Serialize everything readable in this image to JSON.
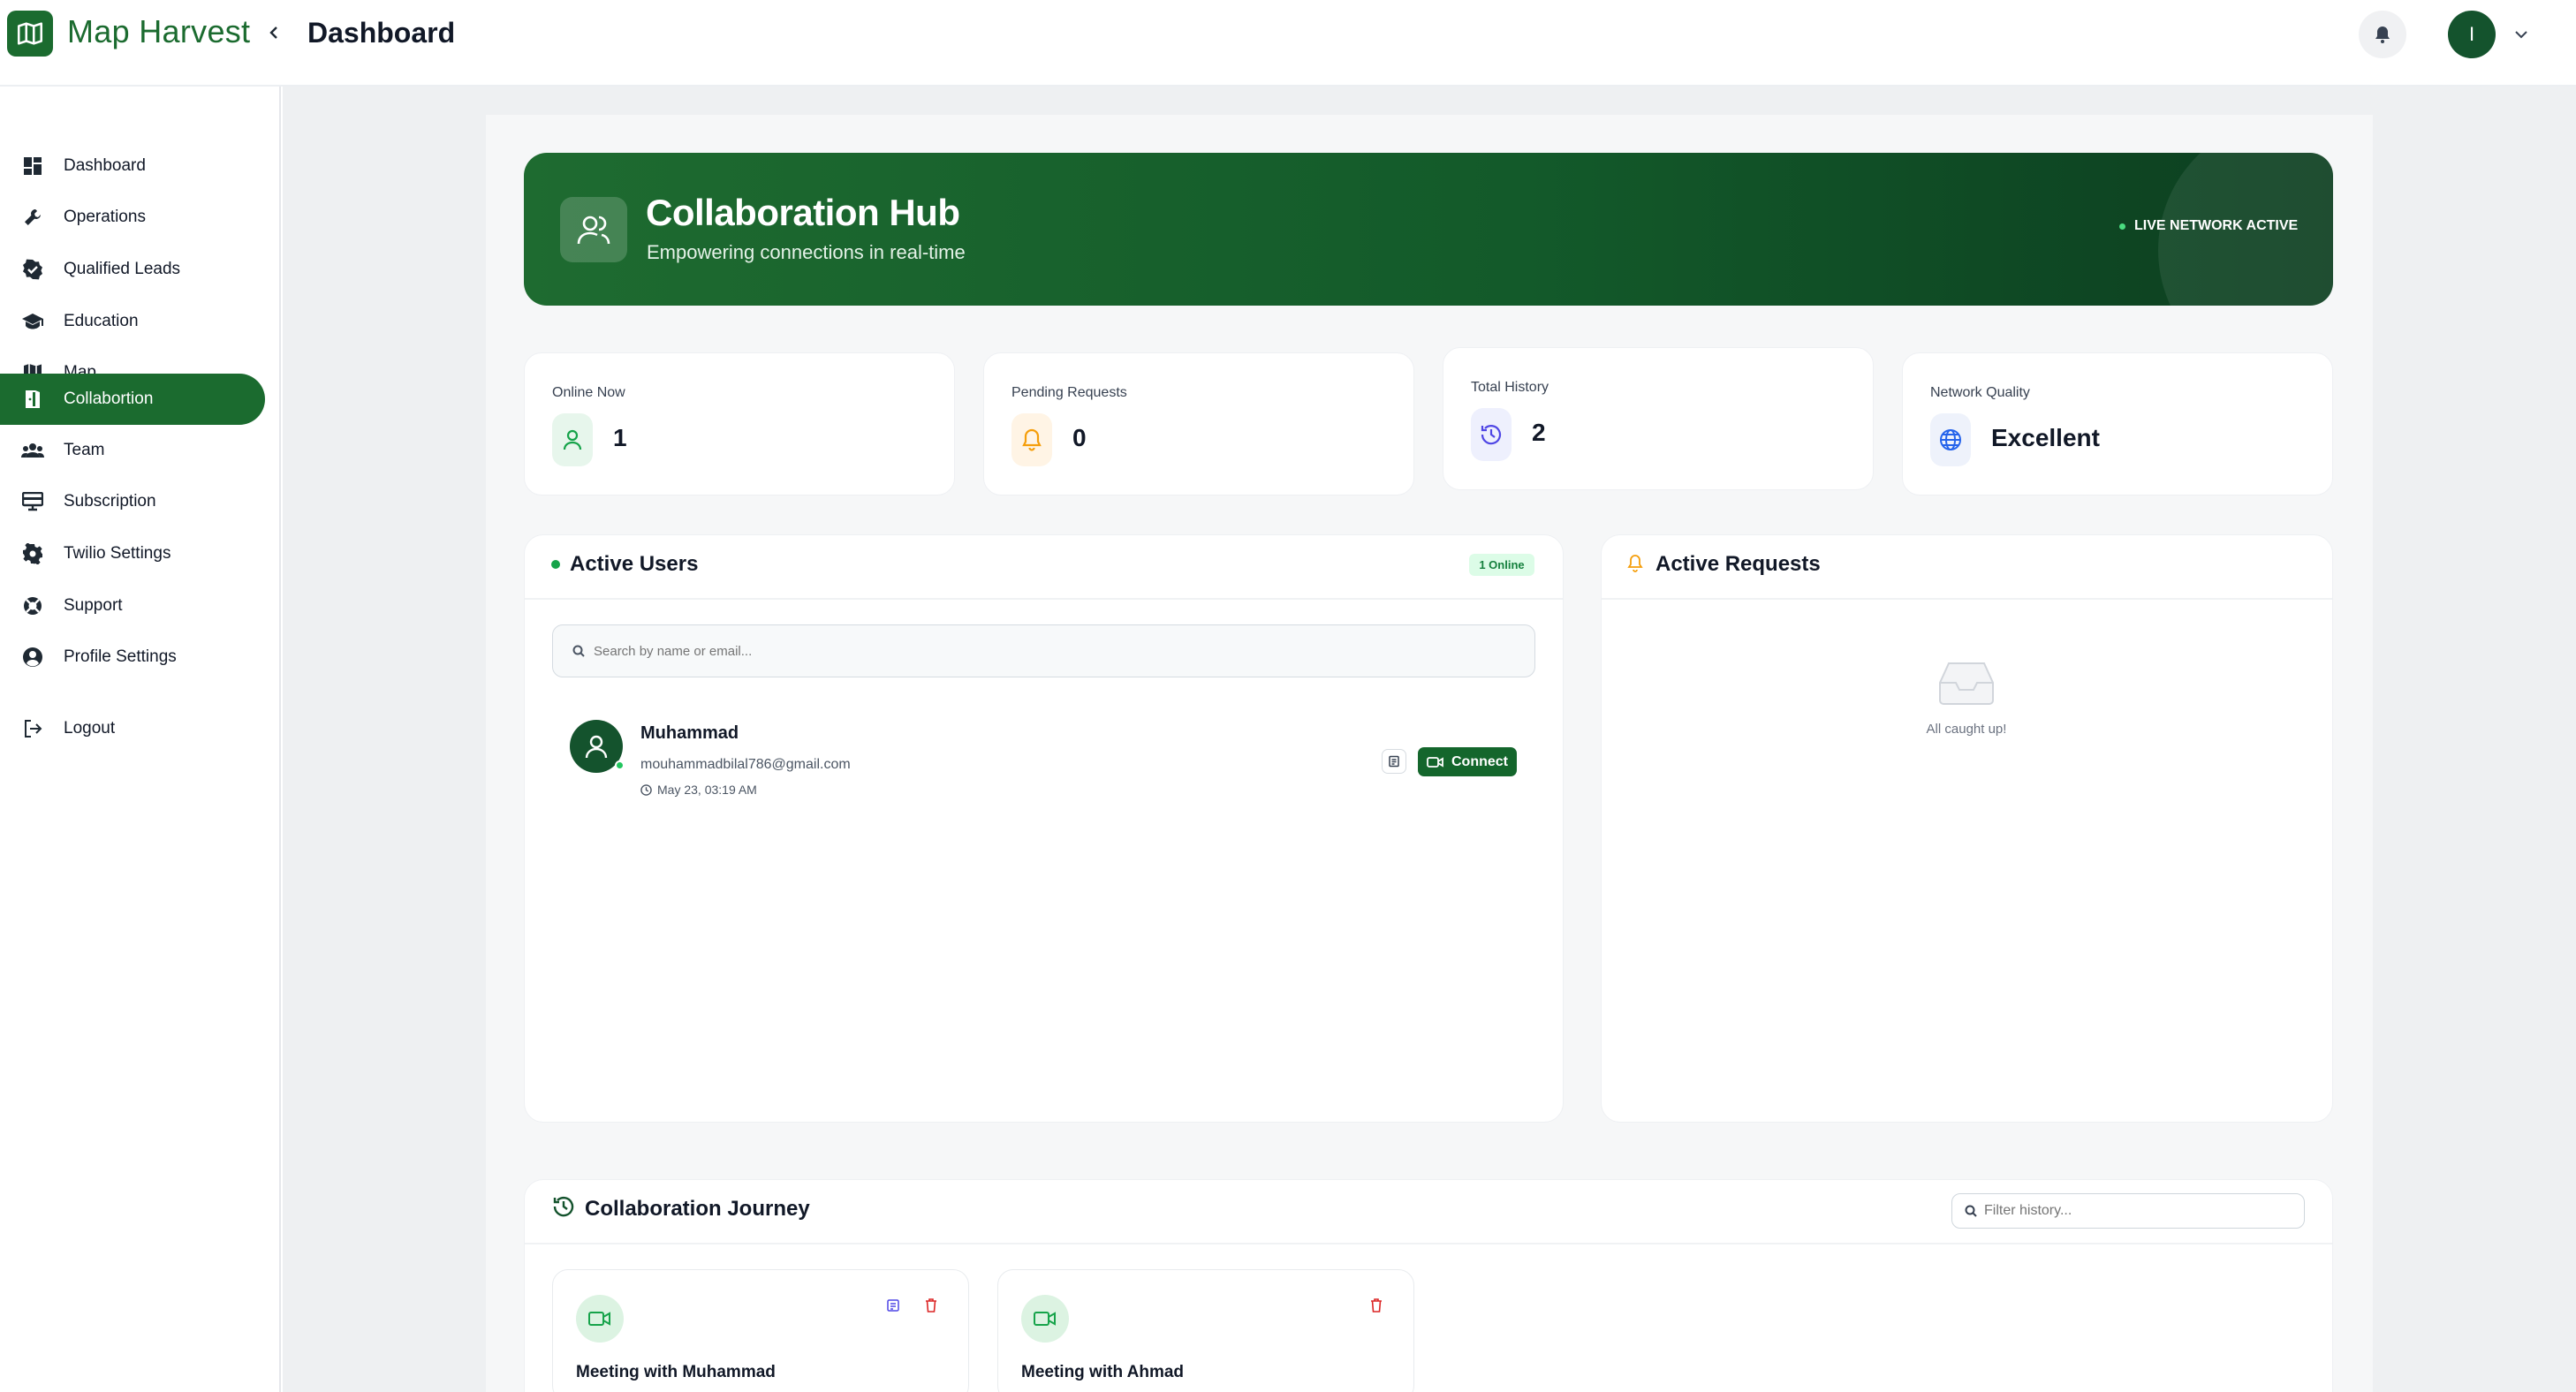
{
  "app": {
    "brand": "Map Harvest",
    "page_title": "Dashboard",
    "user_initial": "I"
  },
  "colors": {
    "brand": "#1b6b2f",
    "accent_dark": "#14532d",
    "online": "#22c55e",
    "warning": "#f59e0b",
    "indigo": "#4f46e5",
    "danger": "#dc2626"
  },
  "sidebar": {
    "items": [
      {
        "label": "Dashboard",
        "icon": "dashboard-icon"
      },
      {
        "label": "Operations",
        "icon": "wrench-icon"
      },
      {
        "label": "Qualified Leads",
        "icon": "verified-badge-icon"
      },
      {
        "label": "Education",
        "icon": "graduation-cap-icon"
      },
      {
        "label": "Map",
        "icon": "map-icon"
      },
      {
        "label": "Collabortion",
        "icon": "door-icon",
        "active": true
      },
      {
        "label": "Team",
        "icon": "group-icon"
      },
      {
        "label": "Subscription",
        "icon": "monitor-icon"
      },
      {
        "label": "Twilio Settings",
        "icon": "gear-icon"
      },
      {
        "label": "Support",
        "icon": "lifebuoy-icon"
      },
      {
        "label": "Profile Settings",
        "icon": "account-circle-icon"
      },
      {
        "label": "Logout",
        "icon": "logout-icon"
      }
    ]
  },
  "hero": {
    "title": "Collaboration Hub",
    "subtitle": "Empowering connections in real-time",
    "status": "LIVE NETWORK ACTIVE"
  },
  "stats": [
    {
      "label": "Online Now",
      "value": "1",
      "icon": "user-icon"
    },
    {
      "label": "Pending Requests",
      "value": "0",
      "icon": "bell-icon"
    },
    {
      "label": "Total History",
      "value": "2",
      "icon": "history-icon"
    },
    {
      "label": "Network Quality",
      "value": "Excellent",
      "icon": "globe-icon"
    }
  ],
  "active_users": {
    "title": "Active Users",
    "badge": "1 Online",
    "search_placeholder": "Search by name or email...",
    "users": [
      {
        "name": "Muhammad",
        "email": "mouhammadbilal786@gmail.com",
        "time": "May 23, 03:19 AM",
        "action": "Connect"
      }
    ]
  },
  "active_requests": {
    "title": "Active Requests",
    "empty_text": "All caught up!"
  },
  "journey": {
    "title": "Collaboration Journey",
    "filter_placeholder": "Filter history...",
    "items": [
      {
        "title": "Meeting with Muhammad"
      },
      {
        "title": "Meeting with Ahmad"
      }
    ]
  }
}
